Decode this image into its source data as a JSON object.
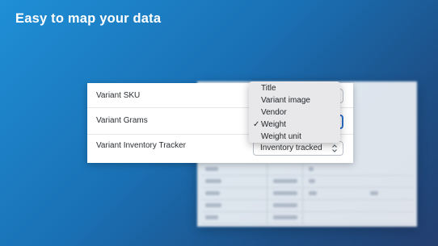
{
  "headline": "Easy to map your data",
  "mapping_rows": [
    {
      "label": "Variant SKU",
      "value": ""
    },
    {
      "label": "Variant Grams",
      "value": ""
    },
    {
      "label": "Variant Inventory Tracker",
      "value": "Inventory tracked"
    }
  ],
  "dropdown": {
    "options": [
      {
        "label": "Title",
        "selected": false
      },
      {
        "label": "Variant image",
        "selected": false
      },
      {
        "label": "Vendor",
        "selected": false
      },
      {
        "label": "Weight",
        "selected": true
      },
      {
        "label": "Weight unit",
        "selected": false
      }
    ],
    "check_glyph": "✓"
  },
  "colors": {
    "accent": "#2c6ecb",
    "headline": "#ffffff"
  },
  "icons": {
    "select_chevron": "chevron-up-down-icon",
    "selected_mark": "checkmark-icon"
  }
}
